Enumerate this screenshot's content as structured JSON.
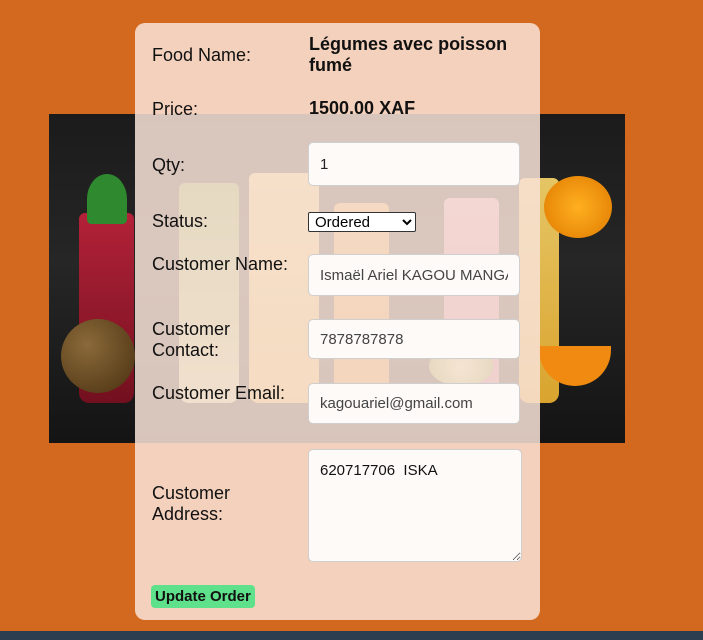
{
  "form": {
    "food_name_label": "Food Name:",
    "food_name_value": "Légumes avec poisson fumé",
    "price_label": "Price:",
    "price_value": "1500.00 XAF",
    "qty_label": "Qty:",
    "qty_value": "1",
    "status_label": "Status:",
    "status_value": "Ordered",
    "customer_name_label": "Customer Name:",
    "customer_name_value": "Ismaël Ariel KAGOU MANGA",
    "customer_contact_label": "Customer Contact:",
    "customer_contact_value": "7878787878",
    "customer_email_label": "Customer Email:",
    "customer_email_value": "kagouariel@gmail.com",
    "customer_address_label": "Customer Address:",
    "customer_address_value": "620717706  ISKA",
    "update_button_label": "Update Order"
  }
}
